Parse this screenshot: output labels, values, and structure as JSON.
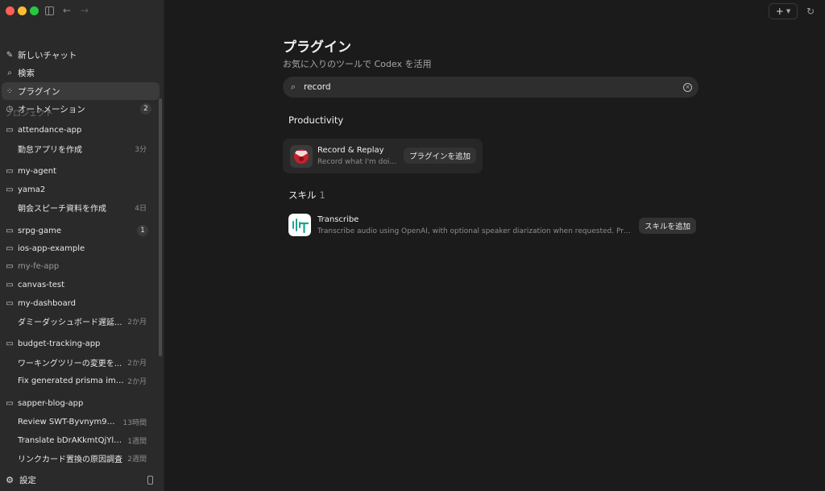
{
  "sidebar": {
    "nav": [
      {
        "label": "新しいチャット",
        "icon": "compose-icon"
      },
      {
        "label": "検索",
        "icon": "search-icon"
      },
      {
        "label": "プラグイン",
        "icon": "plugins-grid-icon",
        "active": true
      },
      {
        "label": "オートメーション",
        "icon": "clock-icon",
        "badge": "2"
      }
    ],
    "section_label": "プロジェクト",
    "projects": [
      {
        "name": "attendance-app"
      },
      {
        "thread": "勤怠アプリを作成",
        "time": "3分"
      },
      {
        "name": "my-agent"
      },
      {
        "name": "yama2"
      },
      {
        "thread": "朝会スピーチ資料を作成",
        "time": "4日"
      },
      {
        "name": "srpg-game",
        "badge": "1"
      },
      {
        "name": "ios-app-example"
      },
      {
        "name": "my-fe-app",
        "muted": true
      },
      {
        "name": "canvas-test"
      },
      {
        "name": "my-dashboard"
      },
      {
        "thread": "ダミーダッシュボード遅延...",
        "time": "2か月"
      },
      {
        "name": "budget-tracking-app"
      },
      {
        "thread": "ワーキングツリーの変更を...",
        "time": "2か月"
      },
      {
        "thread": "Fix generated prisma import",
        "time": "2か月"
      },
      {
        "name": "sapper-blog-app"
      },
      {
        "thread": "Review SWT-Byvnym9BN...",
        "time": "13時間"
      },
      {
        "thread": "Translate bDrAKkmtQjYlbp...",
        "time": "1週間"
      },
      {
        "thread": "リンクカード置換の原因調査",
        "time": "2週間"
      }
    ],
    "footer_label": "設定"
  },
  "main": {
    "title": "プラグイン",
    "subtitle": "お気に入りのツールで Codex を活用",
    "search": {
      "value": "record",
      "placeholder": ""
    },
    "productivity_label": "Productivity",
    "plugin": {
      "name": "Record & Replay",
      "description": "Record what I'm doin...",
      "button": "プラグインを追加"
    },
    "skills_label": "スキル",
    "skills_count": "1",
    "skill": {
      "name": "Transcribe",
      "description": "Transcribe audio using OpenAI, with optional speaker diarization when requested. Prefer...",
      "button": "スキルを追加"
    }
  },
  "colors": {
    "sidebar_bg": "#2a2a2a",
    "main_bg": "#1b1b1b",
    "active_item": "#3b3b3b",
    "transcribe_accent": "#1aa391",
    "record_accent": "#c8202b"
  }
}
